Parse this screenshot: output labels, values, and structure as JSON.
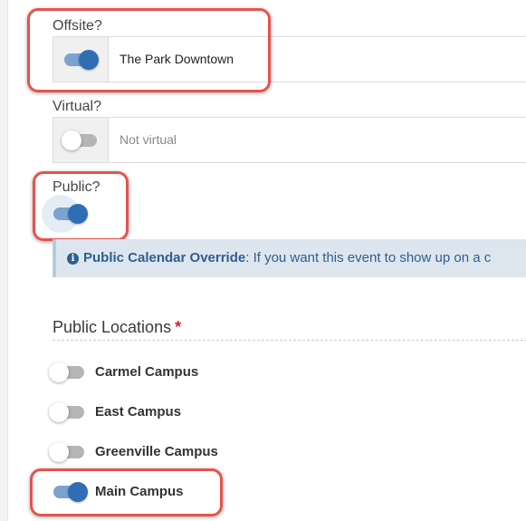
{
  "offsite": {
    "label": "Offsite?",
    "value": "The Park Downtown",
    "toggle_state": "on"
  },
  "virtual": {
    "label": "Virtual?",
    "value": "Not virtual",
    "toggle_state": "off"
  },
  "public": {
    "label": "Public?",
    "toggle_state": "on"
  },
  "info": {
    "icon": "info-icon",
    "icon_glyph": "i",
    "title": "Public Calendar Override",
    "text": ": If you want this event to show up on a c"
  },
  "public_locations": {
    "title": "Public Locations",
    "required_marker": "*",
    "items": [
      {
        "label": "Carmel Campus",
        "toggle_state": "off"
      },
      {
        "label": "East Campus",
        "toggle_state": "off"
      },
      {
        "label": "Greenville Campus",
        "toggle_state": "off"
      },
      {
        "label": "Main Campus",
        "toggle_state": "on"
      }
    ]
  },
  "colors": {
    "accent": "#2f6db5",
    "highlight": "#e8524a",
    "info_bg": "#dde6ef",
    "required": "#e0201b"
  }
}
